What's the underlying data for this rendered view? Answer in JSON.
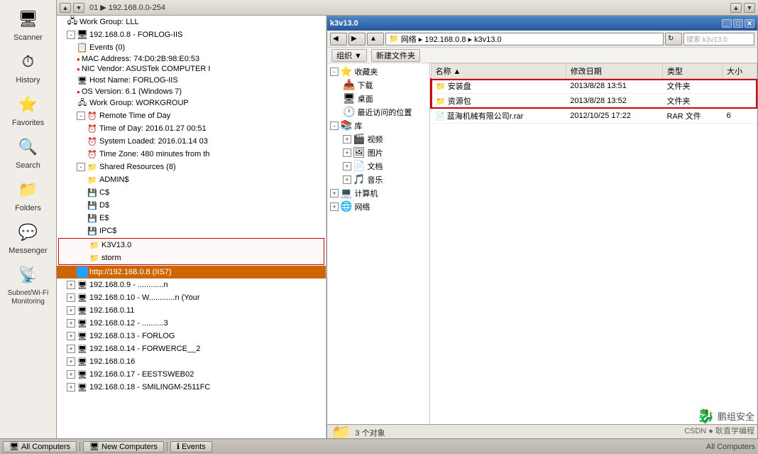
{
  "app": {
    "title": "k3v13.0",
    "address": "01 ▶ 192.168.0.0-254"
  },
  "sidebar": {
    "items": [
      {
        "id": "scanner",
        "label": "Scanner",
        "icon": "🖥"
      },
      {
        "id": "history",
        "label": "History",
        "icon": "⏱"
      },
      {
        "id": "favorites",
        "label": "Favorites",
        "icon": "⭐"
      },
      {
        "id": "search",
        "label": "Search",
        "icon": "🔍"
      },
      {
        "id": "folders",
        "label": "Folders",
        "icon": "📁"
      },
      {
        "id": "messenger",
        "label": "Messenger",
        "icon": "💬"
      },
      {
        "id": "subnet",
        "label": "Subnet/Wi-Fi Monitoring",
        "icon": "📡"
      }
    ]
  },
  "tree": {
    "nodes": [
      {
        "id": "workgroup1",
        "label": "Work Group: LLL",
        "level": 1,
        "icon": "🖧"
      },
      {
        "id": "host1",
        "label": "192.168.0.8 - FORLOG-IIS",
        "level": 1,
        "icon": "🖥",
        "expanded": true
      },
      {
        "id": "events",
        "label": "Events (0)",
        "level": 2,
        "icon": "📋"
      },
      {
        "id": "mac",
        "label": "MAC Address: 74:D0:2B:98:E0:53",
        "level": 2,
        "icon": "🔴"
      },
      {
        "id": "nic",
        "label": "NIC Vendor: ASUSTek COMPUTER I",
        "level": 2,
        "icon": "🔴"
      },
      {
        "id": "hostname",
        "label": "Host Name: FORLOG-IIS",
        "level": 2,
        "icon": "🖥"
      },
      {
        "id": "os",
        "label": "OS Version: 6.1 (Windows 7)",
        "level": 2,
        "icon": "🔴"
      },
      {
        "id": "workgroup2",
        "label": "Work Group: WORKGROUP",
        "level": 2,
        "icon": "🖧"
      },
      {
        "id": "remote",
        "label": "Remote Time of Day",
        "level": 2,
        "icon": "⏰",
        "expanded": true
      },
      {
        "id": "time1",
        "label": "Time of Day: 2016.01.27  00:51",
        "level": 3,
        "icon": "⏰"
      },
      {
        "id": "sysload",
        "label": "System Loaded: 2016.01.14  03",
        "level": 3,
        "icon": "⏰"
      },
      {
        "id": "timezone",
        "label": "Time Zone: 480 minutes from th",
        "level": 3,
        "icon": "⏰"
      },
      {
        "id": "shared",
        "label": "Shared Resources (8)",
        "level": 2,
        "icon": "📁",
        "expanded": true
      },
      {
        "id": "admin",
        "label": "ADMIN$",
        "level": 3,
        "icon": "📁"
      },
      {
        "id": "cs",
        "label": "C$",
        "level": 3,
        "icon": "💾"
      },
      {
        "id": "ds",
        "label": "D$",
        "level": 3,
        "icon": "💾"
      },
      {
        "id": "es",
        "label": "E$",
        "level": 3,
        "icon": "💾"
      },
      {
        "id": "ipcs",
        "label": "IPC$",
        "level": 3,
        "icon": "💾"
      },
      {
        "id": "k3v13",
        "label": "K3V13.0",
        "level": 3,
        "icon": "📁",
        "highlight": true
      },
      {
        "id": "storm",
        "label": "storm",
        "level": 3,
        "icon": "📁"
      },
      {
        "id": "http",
        "label": "http://192.168.0.8 (IIS7)",
        "level": 2,
        "icon": "🌐",
        "selected": true
      },
      {
        "id": "host2",
        "label": "192.168.0.9 - ............n",
        "level": 1,
        "icon": "🖥"
      },
      {
        "id": "host3",
        "label": "192.168.0.10 - W............n (Your",
        "level": 1,
        "icon": "🖥"
      },
      {
        "id": "host4",
        "label": "192.168.0.11",
        "level": 1,
        "icon": "🖥"
      },
      {
        "id": "host5",
        "label": "192.168.0.12 - ..........3",
        "level": 1,
        "icon": "🖥"
      },
      {
        "id": "host6",
        "label": "192.168.0.13 - FORLOG",
        "level": 1,
        "icon": "🖥"
      },
      {
        "id": "host7",
        "label": "192.168.0.14 - FORWERCE__2",
        "level": 1,
        "icon": "🖥"
      },
      {
        "id": "host8",
        "label": "192.168.0.16",
        "level": 1,
        "icon": "🖥"
      },
      {
        "id": "host9",
        "label": "192.168.0.17 - EESTSWEB02",
        "level": 1,
        "icon": "🖥"
      },
      {
        "id": "host10",
        "label": "192.168.0.18 - SMILINGM-2511FC",
        "level": 1,
        "icon": "🖥"
      }
    ]
  },
  "file_explorer": {
    "title": "k3v13.0",
    "path": "网络 ▸ 192.168.0.8 ▸ k3v13.0",
    "search_placeholder": "搜索 k3v13.0",
    "toolbar_buttons": [
      "组织 ▼",
      "新建文件夹"
    ],
    "nav_tree": [
      {
        "label": "收藏夹",
        "icon": "⭐",
        "expanded": true
      },
      {
        "label": "下载",
        "icon": "📥",
        "indent": 1
      },
      {
        "label": "桌面",
        "icon": "🖥",
        "indent": 1
      },
      {
        "label": "最近访问的位置",
        "icon": "🕐",
        "indent": 1
      },
      {
        "label": "库",
        "icon": "📚",
        "expanded": true
      },
      {
        "label": "视频",
        "icon": "🎬",
        "indent": 1
      },
      {
        "label": "图片",
        "icon": "🖼",
        "indent": 1
      },
      {
        "label": "文档",
        "icon": "📄",
        "indent": 1
      },
      {
        "label": "音乐",
        "icon": "🎵",
        "indent": 1
      },
      {
        "label": "计算机",
        "icon": "💻"
      },
      {
        "label": "网络",
        "icon": "🌐"
      }
    ],
    "columns": [
      "名称",
      "修改日期",
      "类型",
      "大小"
    ],
    "files": [
      {
        "name": "安装盘",
        "date": "2013/8/28 13:51",
        "type": "文件夹",
        "size": ""
      },
      {
        "name": "资源包",
        "date": "2013/8/28 13:52",
        "type": "文件夹",
        "size": ""
      },
      {
        "name": "蓝海机械有限公司r.rar",
        "date": "2012/10/25 17:22",
        "type": "RAR 文件",
        "size": "6"
      }
    ],
    "status": "3 个对象"
  },
  "taskbar": {
    "buttons": [
      "All Computers",
      "New Computers",
      "Events"
    ]
  },
  "watermark": {
    "line1": "鹏组安全",
    "line2": "CSDN ● 耿直学编程"
  }
}
